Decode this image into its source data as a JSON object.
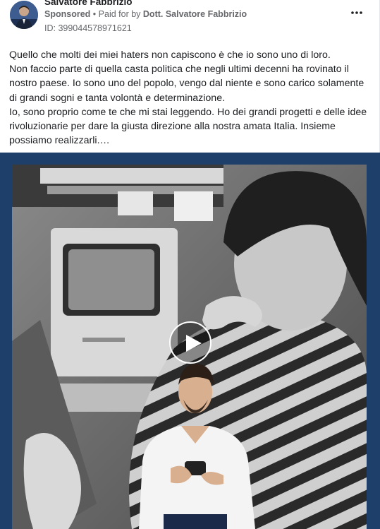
{
  "post": {
    "author": "Salvatore Fabbrizio",
    "sponsored_label": "Sponsored",
    "paid_for_prefix": "Paid for by",
    "paid_for_by": "Dott. Salvatore Fabbrizio",
    "ad_id": "ID: 399044578971621",
    "body": [
      "Quello che molti dei miei haters non capiscono è che io sono uno di loro.",
      "Non faccio parte di quella casta politica che negli ultimi decenni ha rovinato il nostro paese. Io sono uno del popolo, vengo dal niente e sono carico solamente di grandi sogni e tanta volontà e determinazione.",
      "Io, sono proprio come te che mi stai leggendo. Ho dei grandi progetti e delle idee rivoluzionarie per dare la giusta direzione alla nostra amata Italia. Insieme possiamo realizzarli.…"
    ]
  },
  "icons": {
    "more": "more-options-icon",
    "play": "play-icon",
    "bullet": "•"
  },
  "colors": {
    "media_border": "#1e3f6a",
    "meta_text": "#65676b"
  }
}
